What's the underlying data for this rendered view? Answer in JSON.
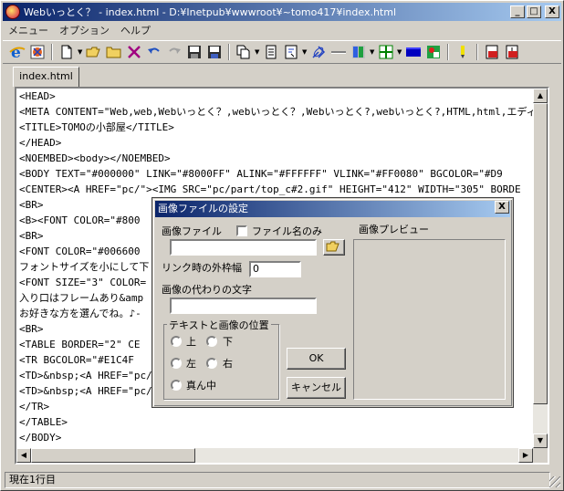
{
  "window": {
    "title": "Webいっとく？ - index.html - D:¥Inetpub¥wwwroot¥~tomo417¥index.html",
    "min_glyph": "_",
    "max_glyph": "□",
    "close_glyph": "X"
  },
  "menu": [
    "メニュー",
    "オプション",
    "ヘルプ"
  ],
  "toolbar": {
    "icons": [
      "ie-icon",
      "html-check-icon",
      "new-file-icon",
      "open-folder-icon",
      "folder-icon",
      "delete-icon",
      "undo-icon",
      "redo-icon",
      "save-icon",
      "save-all-icon",
      "copy-icon",
      "notepad-icon",
      "template-icon",
      "link-icon",
      "hr-icon",
      "image-icon",
      "table-icon",
      "color-bar-icon",
      "picture-icon",
      "marker-icon",
      "frame-icon",
      "frame2-icon"
    ]
  },
  "tab": {
    "label": "index.html"
  },
  "editor": {
    "lines": [
      "<HEAD>",
      "<META CONTENT=\"Web,web,Webいっとく？,webいっとく？,Webいっとく?,webいっとく?,HTML,html,エディ",
      "<TITLE>TOMOの小部屋</TITLE>",
      "</HEAD>",
      "<NOEMBED><body></NOEMBED>",
      "<BODY TEXT=\"#000000\" LINK=\"#8000FF\" ALINK=\"#FFFFFF\" VLINK=\"#FF0080\" BGCOLOR=\"#D9",
      "<CENTER><A HREF=\"pc/\"><IMG SRC=\"pc/part/top_c#2.gif\" HEIGHT=\"412\" WIDTH=\"305\" BORDE",
      "<BR>",
      "<B><FONT COLOR=\"#800",
      "<BR>",
      "<FONT COLOR=\"#006600",
      "フォントサイズを小にして下",
      "<FONT SIZE=\"3\" COLOR=",
      "入り口はフレームあり&amp",
      "お好きな方を選んでね。♪-",
      "<BR>",
      "<TABLE BORDER=\"2\" CE",
      "<TR BGCOLOR=\"#E1C4F",
      "<TD>&nbsp;<A HREF=\"pc/",
      "<TD>&nbsp;<A HREF=\"pc/",
      "</TR>",
      "</TABLE>",
      "</BODY>"
    ]
  },
  "status": {
    "text": "現在1行目"
  },
  "dialog": {
    "title": "画像ファイルの設定",
    "close_glyph": "X",
    "image_file_label": "画像ファイル",
    "filename_only_label": "ファイル名のみ",
    "filename_only_checked": false,
    "image_file_value": "",
    "preview_label": "画像プレビュー",
    "link_border_label": "リンク時の外枠幅",
    "link_border_value": "0",
    "alt_text_label": "画像の代わりの文字",
    "alt_text_value": "",
    "position_group_label": "テキストと画像の位置",
    "positions": {
      "top": "上",
      "bottom": "下",
      "left": "左",
      "right": "右",
      "center": "真ん中"
    },
    "ok_label": "OK",
    "cancel_label": "キャンセル"
  }
}
